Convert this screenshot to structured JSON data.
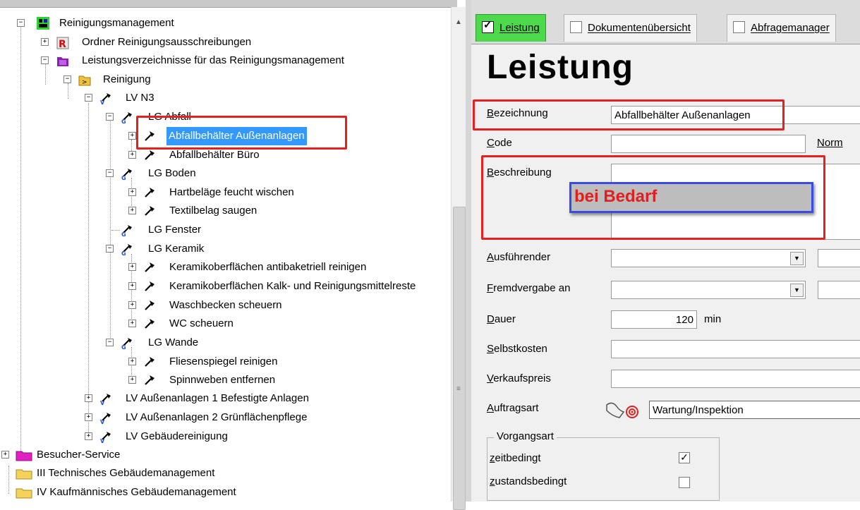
{
  "tree": {
    "nodes": [
      {
        "label": "Reinigungsmanagement"
      },
      {
        "label": "Ordner Reinigungsausschreibungen"
      },
      {
        "label": "Leistungsverzeichnisse für das Reinigungsmanagement"
      },
      {
        "label": "Reinigung"
      },
      {
        "label": "LV N3"
      },
      {
        "label": "LG Abfall"
      },
      {
        "label": "Abfallbehälter Außenanlagen"
      },
      {
        "label": "Abfallbehälter Büro"
      },
      {
        "label": "LG Boden"
      },
      {
        "label": "Hartbeläge feucht wischen"
      },
      {
        "label": "Textilbelag saugen"
      },
      {
        "label": "LG Fenster"
      },
      {
        "label": "LG Keramik"
      },
      {
        "label": "Keramikoberflächen antibaketriell reinigen"
      },
      {
        "label": "Keramikoberflächen Kalk- und Reinigungsmittelreste"
      },
      {
        "label": "Waschbecken scheuern"
      },
      {
        "label": "WC scheuern"
      },
      {
        "label": "LG Wande"
      },
      {
        "label": "Fliesenspiegel reinigen"
      },
      {
        "label": "Spinnweben entfernen"
      },
      {
        "label": "LV Außenanlagen 1 Befestigte Anlagen"
      },
      {
        "label": "LV Außenanlagen 2 Grünflächenpflege"
      },
      {
        "label": "LV Gebäudereinigung"
      },
      {
        "label": "Besucher-Service"
      },
      {
        "label": "III Technisches Gebäudemanagement"
      },
      {
        "label": "IV Kaufmännisches Gebäudemanagement"
      }
    ]
  },
  "tabs": [
    {
      "label": "Leistung",
      "checked": true
    },
    {
      "label": "Dokumentenübersicht",
      "checked": false
    },
    {
      "label": "Abfragemanager",
      "checked": false
    }
  ],
  "form": {
    "heading": "Leistung",
    "bezeichnung_label": "Bezeichnung",
    "bezeichnung_value": "Abfallbehälter Außenanlagen",
    "code_label": "Code",
    "code_value": "",
    "norm_label": "Norm",
    "beschreibung_label": "Beschreibung",
    "beschreibung_overlay": "bei Bedarf",
    "ausfuehrender_label": "Ausführender",
    "fremdvergabe_label": "Fremdvergabe an",
    "dauer_label": "Dauer",
    "dauer_value": "120",
    "dauer_unit": "min",
    "selbstkosten_label": "Selbstkosten",
    "verkaufspreis_label": "Verkaufspreis",
    "auftragsart_label": "Auftragsart",
    "auftragsart_value": "Wartung/Inspektion",
    "vorgangsart_title": "Vorgangsart",
    "zeitbedingt_label": "zeitbedingt",
    "zeitbedingt_checked": true,
    "zustandsbedingt_label": "zustandsbedingt",
    "zustandsbedingt_checked": false
  },
  "colors": {
    "selection": "#3399ff",
    "active_tab": "#4cd94c",
    "annotation_red": "#e62020",
    "annotation_blue": "#3a4be0"
  },
  "icons": [
    "folder-icon",
    "tree-expand-icon",
    "hammer-icon",
    "lv-icon",
    "checkbox-icon",
    "combo-arrow-icon",
    "auftragsart-icon"
  ]
}
